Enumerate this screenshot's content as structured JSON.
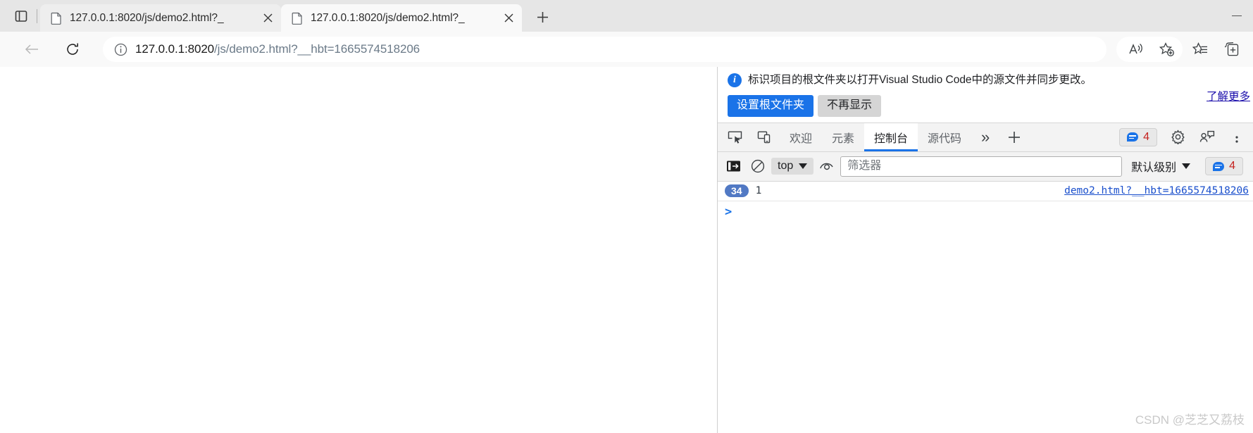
{
  "window": {
    "minimize_label": "—",
    "tab_search_icon": "tab-search-icon"
  },
  "tabs": {
    "items": [
      {
        "title": "127.0.0.1:8020/js/demo2.html?_",
        "favicon": "page-icon",
        "close": "×",
        "active": false
      },
      {
        "title": "127.0.0.1:8020/js/demo2.html?_",
        "favicon": "page-icon",
        "close": "×",
        "active": true
      }
    ],
    "new_tab_label": "+"
  },
  "navbar": {
    "back_icon": "back-arrow-icon",
    "reload_icon": "reload-icon",
    "site_info_icon": "info-circle-icon",
    "url_host": "127.0.0.1:8020",
    "url_path": "/js/demo2.html?__hbt=1665574518206",
    "url_full": "127.0.0.1:8020/js/demo2.html?__hbt=1665574518206",
    "read_aloud_icon": "read-aloud-icon",
    "add_favorite_icon": "add-favorite-star-icon",
    "favorites_icon": "favorites-list-icon",
    "collections_icon": "collections-icon"
  },
  "infobar": {
    "icon": "info-icon",
    "message": "标识项目的根文件夹以打开Visual Studio Code中的源文件并同步更改。",
    "learn_more": "了解更多",
    "primary_button": "设置根文件夹",
    "secondary_button": "不再显示",
    "primary_color": "#1a73e8"
  },
  "devtools": {
    "inspect_icon": "inspect-element-icon",
    "device_icon": "device-toolbar-icon",
    "tabs": [
      {
        "label": "欢迎",
        "active": false
      },
      {
        "label": "元素",
        "active": false
      },
      {
        "label": "控制台",
        "active": true
      },
      {
        "label": "源代码",
        "active": false
      }
    ],
    "more_tabs": "»",
    "add_panel": "+",
    "issues_count": "4",
    "settings_icon": "gear-icon",
    "feedback_icon": "feedback-icon",
    "overflow_icon": "more-vertical-icon",
    "accent_color": "#1a73e8"
  },
  "console_toolbar": {
    "sidebar_toggle_icon": "console-sidebar-icon",
    "clear_icon": "clear-console-icon",
    "context_value": "top",
    "eye_icon": "live-expression-eye-icon",
    "filter_placeholder": "筛选器",
    "filter_value": "",
    "level_value": "默认级别",
    "message_count": "4"
  },
  "console": {
    "messages": [
      {
        "repeat_count": "34",
        "text": "1",
        "source": "demo2.html?__hbt=1665574518206"
      }
    ],
    "prompt_symbol": ">",
    "prompt_value": ""
  },
  "watermark": {
    "text": "CSDN @芝芝又荔枝"
  }
}
